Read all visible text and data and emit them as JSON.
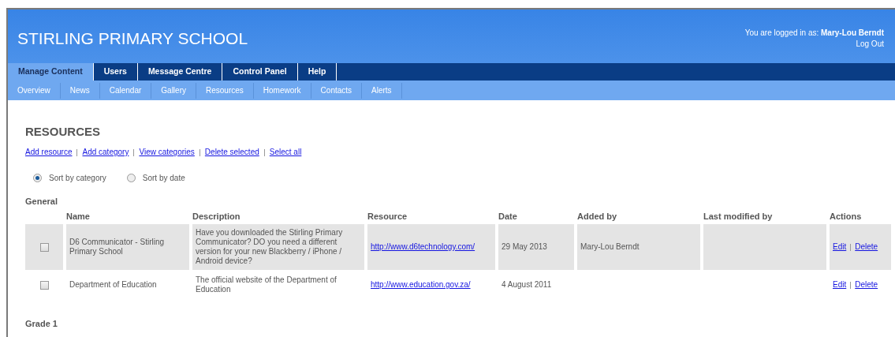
{
  "header": {
    "title": "STIRLING PRIMARY SCHOOL",
    "login_label": "You are logged in as:",
    "user": "Mary-Lou Berndt",
    "logout": "Log Out"
  },
  "tabs": [
    {
      "label": "Manage Content",
      "selected": true
    },
    {
      "label": "Users",
      "selected": false
    },
    {
      "label": "Message Centre",
      "selected": false
    },
    {
      "label": "Control Panel",
      "selected": false
    },
    {
      "label": "Help",
      "selected": false
    }
  ],
  "subnav": [
    "Overview",
    "News",
    "Calendar",
    "Gallery",
    "Resources",
    "Homework",
    "Contacts",
    "Alerts"
  ],
  "page_title": "RESOURCES",
  "actions": [
    "Add resource",
    "Add category",
    "View categories",
    "Delete selected",
    "Select all"
  ],
  "sort_options": [
    {
      "label": "Sort by category",
      "selected": true
    },
    {
      "label": "Sort by date",
      "selected": false
    }
  ],
  "columns": [
    "Name",
    "Description",
    "Resource",
    "Date",
    "Added by",
    "Last modified by",
    "Actions"
  ],
  "categories": [
    {
      "name": "General",
      "rows": [
        {
          "checked": false,
          "highlighted": true,
          "name": "D6 Communicator - Stirling Primary School",
          "description": "Have you downloaded the Stirling Primary Communicator? DO you need a different version for your new Blackberry / iPhone / Android device?",
          "resource": "http://www.d6technology.com/",
          "date": "29 May 2013",
          "added_by": "Mary-Lou Berndt",
          "edit": "Edit",
          "delete": "Delete"
        },
        {
          "checked": false,
          "highlighted": false,
          "name": "Department of Education",
          "description": "The official website of the Department of Education",
          "resource": "http://www.education.gov.za/",
          "date": "4 August 2011",
          "edit": "Edit",
          "delete": "Delete"
        }
      ]
    },
    {
      "name": "Grade 1"
    }
  ]
}
